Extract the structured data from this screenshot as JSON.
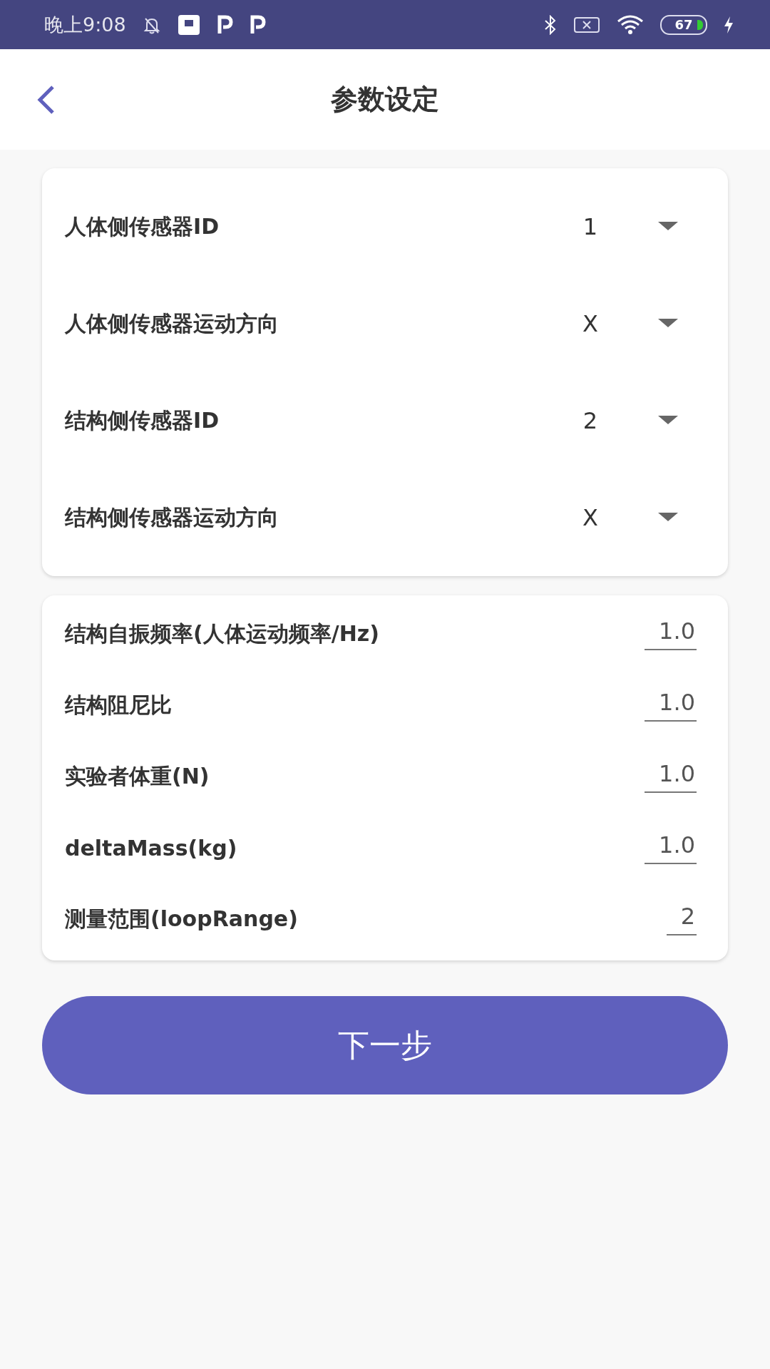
{
  "status_bar": {
    "time": "晚上9:08",
    "battery": "67"
  },
  "app_bar": {
    "title": "参数设定"
  },
  "selectors": [
    {
      "label": "人体侧传感器ID",
      "value": "1"
    },
    {
      "label": "人体侧传感器运动方向",
      "value": "X"
    },
    {
      "label": "结构侧传感器ID",
      "value": "2"
    },
    {
      "label": "结构侧传感器运动方向",
      "value": "X"
    }
  ],
  "inputs": [
    {
      "label": "结构自振频率(人体运动频率/Hz)",
      "value": "1.0"
    },
    {
      "label": "结构阻尼比",
      "value": "1.0"
    },
    {
      "label": "实验者体重(N)",
      "value": "1.0"
    },
    {
      "label": "deltaMass(kg)",
      "value": "1.0"
    },
    {
      "label": "测量范围(loopRange)",
      "value": "2"
    }
  ],
  "next_button": {
    "label": "下一步"
  }
}
